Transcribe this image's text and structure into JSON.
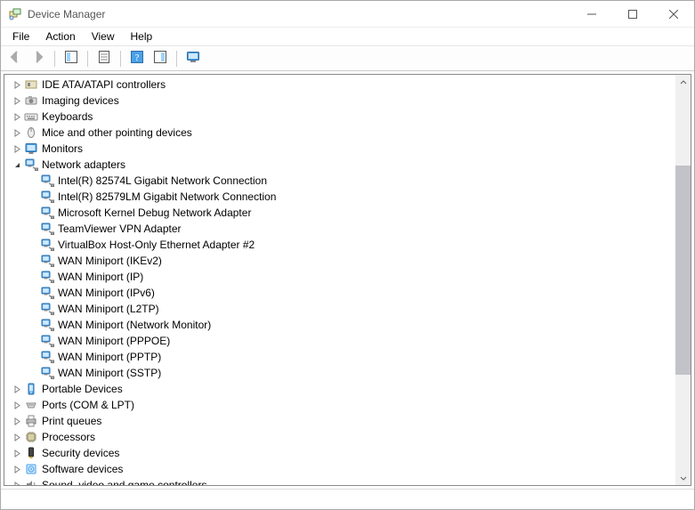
{
  "window": {
    "title": "Device Manager"
  },
  "menu": {
    "items": [
      "File",
      "Action",
      "View",
      "Help"
    ]
  },
  "toolbar": {
    "buttons": [
      {
        "name": "back-button",
        "icon": "arrow-left",
        "enabled": false
      },
      {
        "name": "forward-button",
        "icon": "arrow-right",
        "enabled": false
      },
      {
        "sep": true
      },
      {
        "name": "show-hide-console-tree-button",
        "icon": "console-tree",
        "enabled": true
      },
      {
        "sep": true
      },
      {
        "name": "properties-button",
        "icon": "properties",
        "enabled": true
      },
      {
        "sep": true
      },
      {
        "name": "help-button",
        "icon": "help",
        "enabled": true
      },
      {
        "name": "action-toolbar-button",
        "icon": "action-pane",
        "enabled": true
      },
      {
        "sep": true
      },
      {
        "name": "scan-hardware-button",
        "icon": "monitor-scan",
        "enabled": true
      }
    ]
  },
  "tree": {
    "nodes": [
      {
        "label": "IDE ATA/ATAPI controllers",
        "icon": "ide",
        "depth": 1,
        "expandable": true,
        "expanded": false
      },
      {
        "label": "Imaging devices",
        "icon": "imaging",
        "depth": 1,
        "expandable": true,
        "expanded": false
      },
      {
        "label": "Keyboards",
        "icon": "keyboard",
        "depth": 1,
        "expandable": true,
        "expanded": false
      },
      {
        "label": "Mice and other pointing devices",
        "icon": "mouse",
        "depth": 1,
        "expandable": true,
        "expanded": false
      },
      {
        "label": "Monitors",
        "icon": "monitor",
        "depth": 1,
        "expandable": true,
        "expanded": false
      },
      {
        "label": "Network adapters",
        "icon": "network",
        "depth": 1,
        "expandable": true,
        "expanded": true
      },
      {
        "label": "Intel(R) 82574L Gigabit Network Connection",
        "icon": "network",
        "depth": 2,
        "expandable": false
      },
      {
        "label": "Intel(R) 82579LM Gigabit Network Connection",
        "icon": "network",
        "depth": 2,
        "expandable": false
      },
      {
        "label": "Microsoft Kernel Debug Network Adapter",
        "icon": "network",
        "depth": 2,
        "expandable": false
      },
      {
        "label": "TeamViewer VPN Adapter",
        "icon": "network",
        "depth": 2,
        "expandable": false
      },
      {
        "label": "VirtualBox Host-Only Ethernet Adapter #2",
        "icon": "network",
        "depth": 2,
        "expandable": false
      },
      {
        "label": "WAN Miniport (IKEv2)",
        "icon": "network",
        "depth": 2,
        "expandable": false
      },
      {
        "label": "WAN Miniport (IP)",
        "icon": "network",
        "depth": 2,
        "expandable": false
      },
      {
        "label": "WAN Miniport (IPv6)",
        "icon": "network",
        "depth": 2,
        "expandable": false
      },
      {
        "label": "WAN Miniport (L2TP)",
        "icon": "network",
        "depth": 2,
        "expandable": false
      },
      {
        "label": "WAN Miniport (Network Monitor)",
        "icon": "network",
        "depth": 2,
        "expandable": false
      },
      {
        "label": "WAN Miniport (PPPOE)",
        "icon": "network",
        "depth": 2,
        "expandable": false
      },
      {
        "label": "WAN Miniport (PPTP)",
        "icon": "network",
        "depth": 2,
        "expandable": false
      },
      {
        "label": "WAN Miniport (SSTP)",
        "icon": "network",
        "depth": 2,
        "expandable": false
      },
      {
        "label": "Portable Devices",
        "icon": "portable",
        "depth": 1,
        "expandable": true,
        "expanded": false
      },
      {
        "label": "Ports (COM & LPT)",
        "icon": "ports",
        "depth": 1,
        "expandable": true,
        "expanded": false
      },
      {
        "label": "Print queues",
        "icon": "printer",
        "depth": 1,
        "expandable": true,
        "expanded": false
      },
      {
        "label": "Processors",
        "icon": "processor",
        "depth": 1,
        "expandable": true,
        "expanded": false
      },
      {
        "label": "Security devices",
        "icon": "security",
        "depth": 1,
        "expandable": true,
        "expanded": false
      },
      {
        "label": "Software devices",
        "icon": "software",
        "depth": 1,
        "expandable": true,
        "expanded": false
      },
      {
        "label": "Sound, video and game controllers",
        "icon": "sound",
        "depth": 1,
        "expandable": true,
        "expanded": false
      }
    ]
  },
  "scrollbar": {
    "thumb_top_pct": 20,
    "thumb_height_pct": 55
  }
}
